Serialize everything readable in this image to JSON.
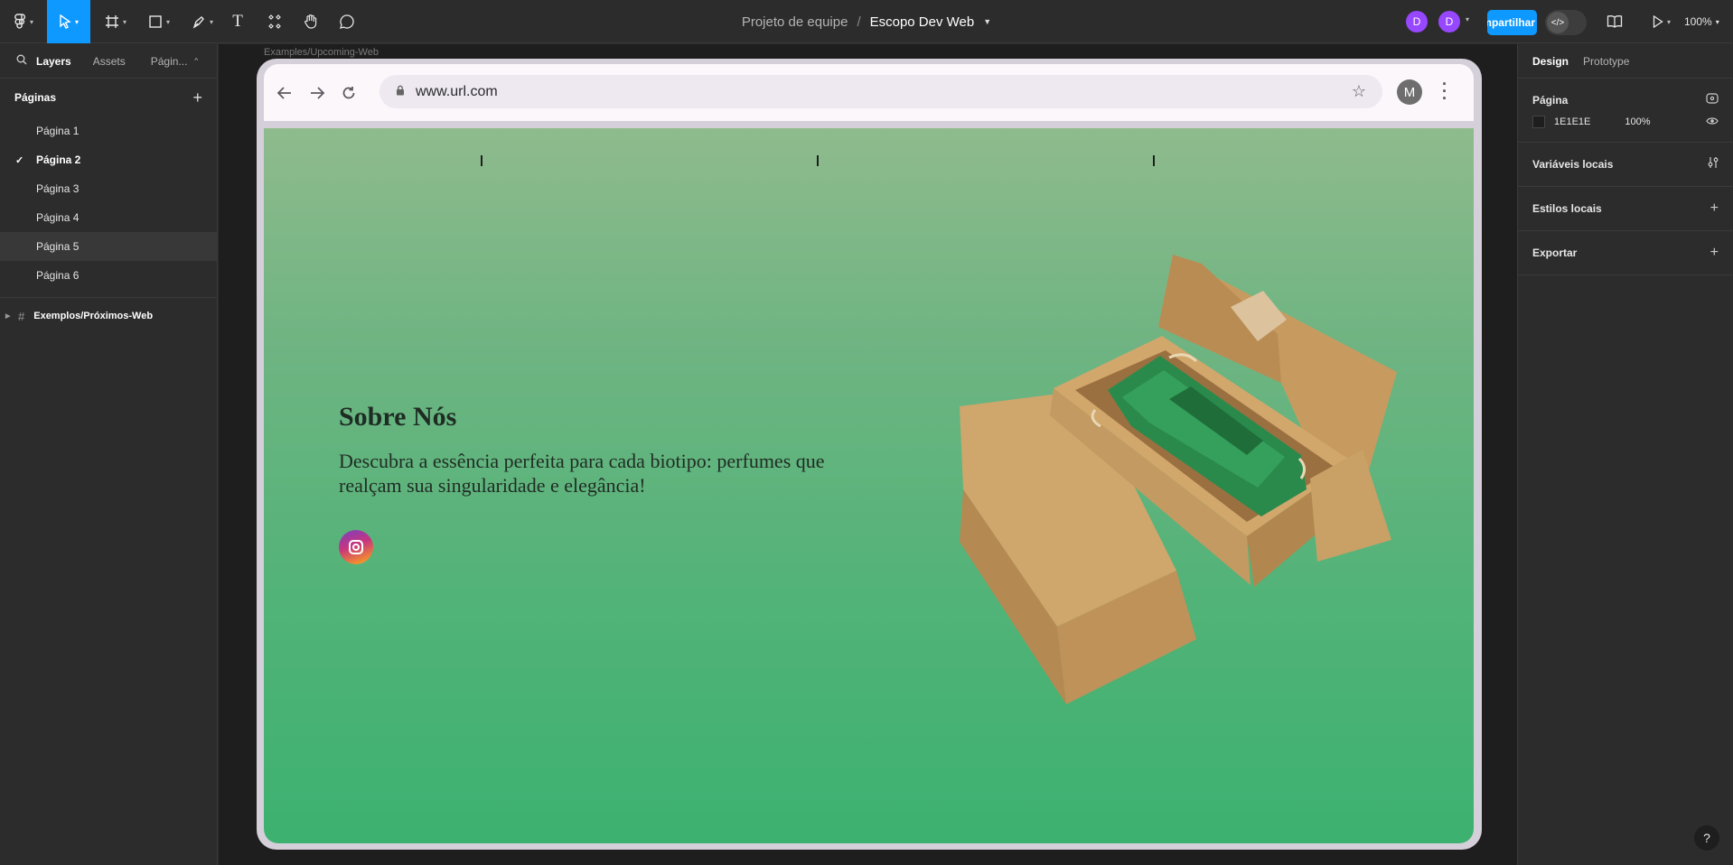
{
  "toolbar": {
    "zoom": "100%"
  },
  "file": {
    "team": "Projeto de equipe",
    "separator": "/",
    "name": "Escopo Dev Web"
  },
  "collaborators": [
    "D",
    "D"
  ],
  "share_label": "Compartilhar",
  "left_panel": {
    "tabs": [
      "Layers",
      "Assets",
      "Págin..."
    ],
    "pages_heading": "Páginas",
    "pages": [
      "Página 1",
      "Página 2",
      "Página 3",
      "Página 4",
      "Página 5",
      "Página 6"
    ],
    "current_page": "Página 2",
    "layer": "Exemplos/Próximos-Web"
  },
  "canvas": {
    "frame_label": "Examples/Upcoming-Web",
    "browser": {
      "url": "www.url.com",
      "profile_initial": "M"
    },
    "site": {
      "title": "Sobre Nós",
      "text": "Descubra a essência perfeita para cada biotipo: perfumes que realçam sua singularidade e elegância!"
    }
  },
  "right_panel": {
    "tabs": [
      "Design",
      "Prototype"
    ],
    "page_section": "Página",
    "page_color": "1E1E1E",
    "page_opacity": "100%",
    "local_variables": "Variáveis locais",
    "local_styles": "Estilos locais",
    "export": "Exportar"
  },
  "help": "?"
}
